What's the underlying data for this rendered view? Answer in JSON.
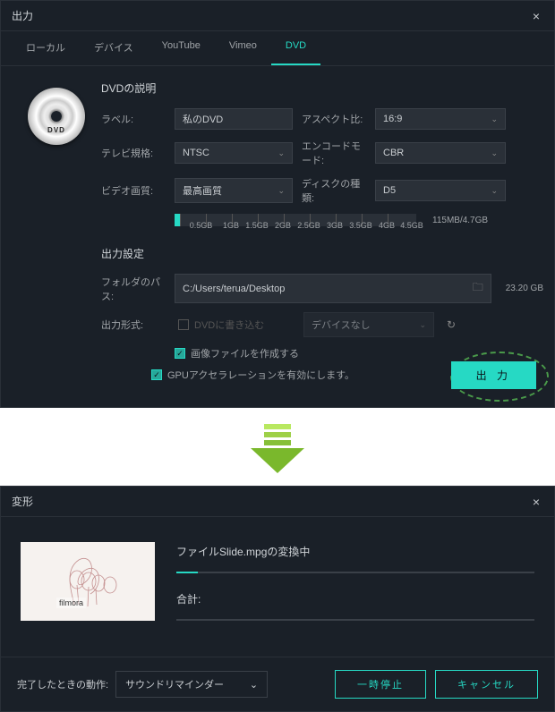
{
  "dialog1": {
    "title": "出力",
    "tabs": [
      "ローカル",
      "デバイス",
      "YouTube",
      "Vimeo",
      "DVD"
    ],
    "active_tab": "DVD",
    "dvd_label": "DVD",
    "section_desc": "DVDの説明",
    "fields": {
      "label_label": "ラベル:",
      "label_value": "私のDVD",
      "aspect_label": "アスペクト比:",
      "aspect_value": "16:9",
      "tvstd_label": "テレビ規格:",
      "tvstd_value": "NTSC",
      "encode_label": "エンコードモード:",
      "encode_value": "CBR",
      "vquality_label": "ビデオ画質:",
      "vquality_value": "最高画質",
      "disctype_label": "ディスクの種類:",
      "disctype_value": "D5"
    },
    "size_points": [
      "0.5GB",
      "1GB",
      "1.5GB",
      "2GB",
      "2.5GB",
      "3GB",
      "3.5GB",
      "4GB",
      "4.5GB"
    ],
    "size_used": "115MB/4.7GB",
    "section_out": "出力設定",
    "folder_label": "フォルダのパス:",
    "folder_value": "C:/Users/terua/Desktop",
    "folder_space": "23.20 GB",
    "format_label": "出力形式:",
    "write_dvd": "DVDに書き込む",
    "device_none": "デバイスなし",
    "chk_img": "画像ファイルを作成する",
    "chk_gpu": "GPUアクセラレーションを有効にします。",
    "export_btn": "出 力"
  },
  "dialog2": {
    "title": "変形",
    "converting": "ファイルSlide.mpgの変換中",
    "total_label": "合計:",
    "progress_pct": 6,
    "total_pct": 0,
    "watermark": "filmora",
    "footer_label": "完了したときの動作:",
    "action_value": "サウンドリマインダー",
    "pause_btn": "一時停止",
    "cancel_btn": "キャンセル"
  }
}
